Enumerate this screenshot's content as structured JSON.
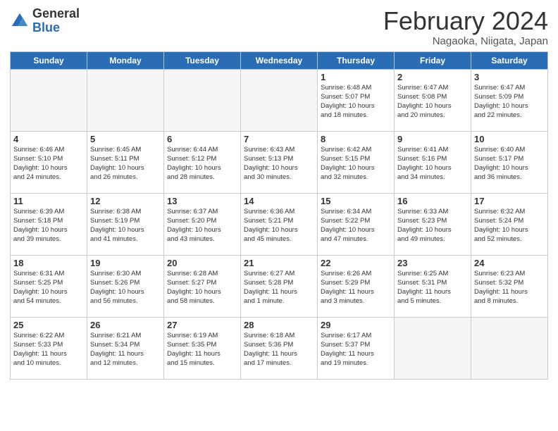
{
  "header": {
    "logo_general": "General",
    "logo_blue": "Blue",
    "title": "February 2024",
    "subtitle": "Nagaoka, Niigata, Japan"
  },
  "weekdays": [
    "Sunday",
    "Monday",
    "Tuesday",
    "Wednesday",
    "Thursday",
    "Friday",
    "Saturday"
  ],
  "weeks": [
    [
      {
        "day": "",
        "info": ""
      },
      {
        "day": "",
        "info": ""
      },
      {
        "day": "",
        "info": ""
      },
      {
        "day": "",
        "info": ""
      },
      {
        "day": "1",
        "info": "Sunrise: 6:48 AM\nSunset: 5:07 PM\nDaylight: 10 hours\nand 18 minutes."
      },
      {
        "day": "2",
        "info": "Sunrise: 6:47 AM\nSunset: 5:08 PM\nDaylight: 10 hours\nand 20 minutes."
      },
      {
        "day": "3",
        "info": "Sunrise: 6:47 AM\nSunset: 5:09 PM\nDaylight: 10 hours\nand 22 minutes."
      }
    ],
    [
      {
        "day": "4",
        "info": "Sunrise: 6:46 AM\nSunset: 5:10 PM\nDaylight: 10 hours\nand 24 minutes."
      },
      {
        "day": "5",
        "info": "Sunrise: 6:45 AM\nSunset: 5:11 PM\nDaylight: 10 hours\nand 26 minutes."
      },
      {
        "day": "6",
        "info": "Sunrise: 6:44 AM\nSunset: 5:12 PM\nDaylight: 10 hours\nand 28 minutes."
      },
      {
        "day": "7",
        "info": "Sunrise: 6:43 AM\nSunset: 5:13 PM\nDaylight: 10 hours\nand 30 minutes."
      },
      {
        "day": "8",
        "info": "Sunrise: 6:42 AM\nSunset: 5:15 PM\nDaylight: 10 hours\nand 32 minutes."
      },
      {
        "day": "9",
        "info": "Sunrise: 6:41 AM\nSunset: 5:16 PM\nDaylight: 10 hours\nand 34 minutes."
      },
      {
        "day": "10",
        "info": "Sunrise: 6:40 AM\nSunset: 5:17 PM\nDaylight: 10 hours\nand 36 minutes."
      }
    ],
    [
      {
        "day": "11",
        "info": "Sunrise: 6:39 AM\nSunset: 5:18 PM\nDaylight: 10 hours\nand 39 minutes."
      },
      {
        "day": "12",
        "info": "Sunrise: 6:38 AM\nSunset: 5:19 PM\nDaylight: 10 hours\nand 41 minutes."
      },
      {
        "day": "13",
        "info": "Sunrise: 6:37 AM\nSunset: 5:20 PM\nDaylight: 10 hours\nand 43 minutes."
      },
      {
        "day": "14",
        "info": "Sunrise: 6:36 AM\nSunset: 5:21 PM\nDaylight: 10 hours\nand 45 minutes."
      },
      {
        "day": "15",
        "info": "Sunrise: 6:34 AM\nSunset: 5:22 PM\nDaylight: 10 hours\nand 47 minutes."
      },
      {
        "day": "16",
        "info": "Sunrise: 6:33 AM\nSunset: 5:23 PM\nDaylight: 10 hours\nand 49 minutes."
      },
      {
        "day": "17",
        "info": "Sunrise: 6:32 AM\nSunset: 5:24 PM\nDaylight: 10 hours\nand 52 minutes."
      }
    ],
    [
      {
        "day": "18",
        "info": "Sunrise: 6:31 AM\nSunset: 5:25 PM\nDaylight: 10 hours\nand 54 minutes."
      },
      {
        "day": "19",
        "info": "Sunrise: 6:30 AM\nSunset: 5:26 PM\nDaylight: 10 hours\nand 56 minutes."
      },
      {
        "day": "20",
        "info": "Sunrise: 6:28 AM\nSunset: 5:27 PM\nDaylight: 10 hours\nand 58 minutes."
      },
      {
        "day": "21",
        "info": "Sunrise: 6:27 AM\nSunset: 5:28 PM\nDaylight: 11 hours\nand 1 minute."
      },
      {
        "day": "22",
        "info": "Sunrise: 6:26 AM\nSunset: 5:29 PM\nDaylight: 11 hours\nand 3 minutes."
      },
      {
        "day": "23",
        "info": "Sunrise: 6:25 AM\nSunset: 5:31 PM\nDaylight: 11 hours\nand 5 minutes."
      },
      {
        "day": "24",
        "info": "Sunrise: 6:23 AM\nSunset: 5:32 PM\nDaylight: 11 hours\nand 8 minutes."
      }
    ],
    [
      {
        "day": "25",
        "info": "Sunrise: 6:22 AM\nSunset: 5:33 PM\nDaylight: 11 hours\nand 10 minutes."
      },
      {
        "day": "26",
        "info": "Sunrise: 6:21 AM\nSunset: 5:34 PM\nDaylight: 11 hours\nand 12 minutes."
      },
      {
        "day": "27",
        "info": "Sunrise: 6:19 AM\nSunset: 5:35 PM\nDaylight: 11 hours\nand 15 minutes."
      },
      {
        "day": "28",
        "info": "Sunrise: 6:18 AM\nSunset: 5:36 PM\nDaylight: 11 hours\nand 17 minutes."
      },
      {
        "day": "29",
        "info": "Sunrise: 6:17 AM\nSunset: 5:37 PM\nDaylight: 11 hours\nand 19 minutes."
      },
      {
        "day": "",
        "info": ""
      },
      {
        "day": "",
        "info": ""
      }
    ]
  ]
}
